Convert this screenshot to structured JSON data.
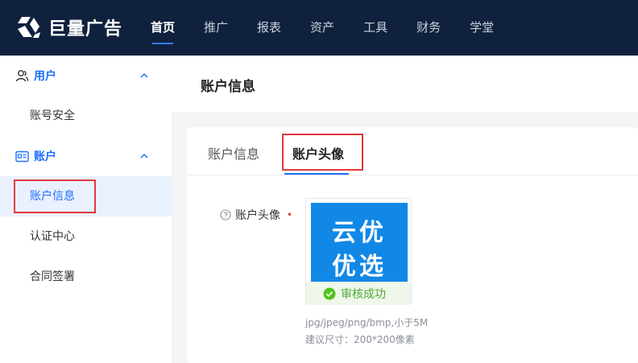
{
  "app": {
    "logo_text": "巨量广告"
  },
  "nav": {
    "items": [
      {
        "label": "首页",
        "active": true
      },
      {
        "label": "推广"
      },
      {
        "label": "报表"
      },
      {
        "label": "资产"
      },
      {
        "label": "工具"
      },
      {
        "label": "财务"
      },
      {
        "label": "学堂"
      }
    ]
  },
  "sidebar": {
    "groups": [
      {
        "label": "用户",
        "icon": "user-icon",
        "items": [
          {
            "label": "账号安全"
          }
        ]
      },
      {
        "label": "账户",
        "icon": "account-card-icon",
        "items": [
          {
            "label": "账户信息",
            "active": true
          },
          {
            "label": "认证中心"
          },
          {
            "label": "合同签署"
          }
        ]
      }
    ]
  },
  "main": {
    "page_title": "账户信息",
    "tabs": [
      {
        "label": "账户信息"
      },
      {
        "label": "账户头像",
        "active": true
      }
    ],
    "form": {
      "avatar_label": "账户头像",
      "required_mark": "•",
      "avatar_text_line1": "云优",
      "avatar_text_line2": "优选",
      "status_text": "审核成功",
      "hint_format": "jpg/jpeg/png/bmp,小于5M",
      "hint_size": "建议尺寸：200*200像素"
    }
  },
  "colors": {
    "topbar": "#10213d",
    "accent": "#1f6fff",
    "highlight_box": "#e0393e",
    "success": "#52a83a",
    "avatar_bg": "#1188e6"
  }
}
